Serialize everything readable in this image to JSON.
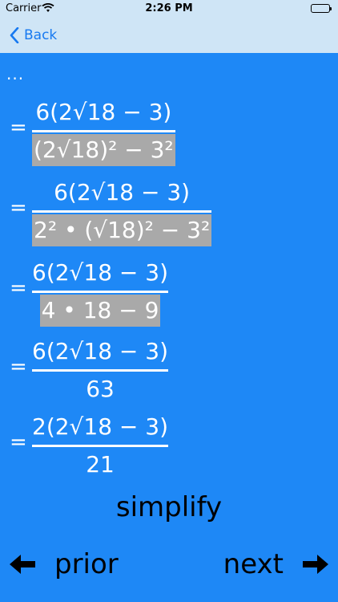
{
  "status": {
    "carrier": "Carrier",
    "time": "2:26 PM"
  },
  "nav": {
    "back_label": "Back"
  },
  "content": {
    "ellipsis": "...",
    "steps": [
      {
        "eq": "=",
        "num": "6(2√18 − 3)",
        "den": "(2√18)² − 3²"
      },
      {
        "eq": "=",
        "num": "6(2√18 − 3)",
        "den": "2² • (√18)² − 3²"
      },
      {
        "eq": "=",
        "num": "6(2√18 − 3)",
        "den": "4 • 18 − 9"
      },
      {
        "eq": "=",
        "num": "6(2√18 − 3)",
        "den": "63"
      },
      {
        "eq": "=",
        "num": "2(2√18 − 3)",
        "den": "21"
      }
    ]
  },
  "actions": {
    "simplify": "simplify",
    "prior": "prior",
    "next": "next"
  },
  "colors": {
    "background": "#1e88f6",
    "navbar": "#cfe5f6",
    "highlight": "#a9a9a9",
    "link": "#1779f0"
  }
}
